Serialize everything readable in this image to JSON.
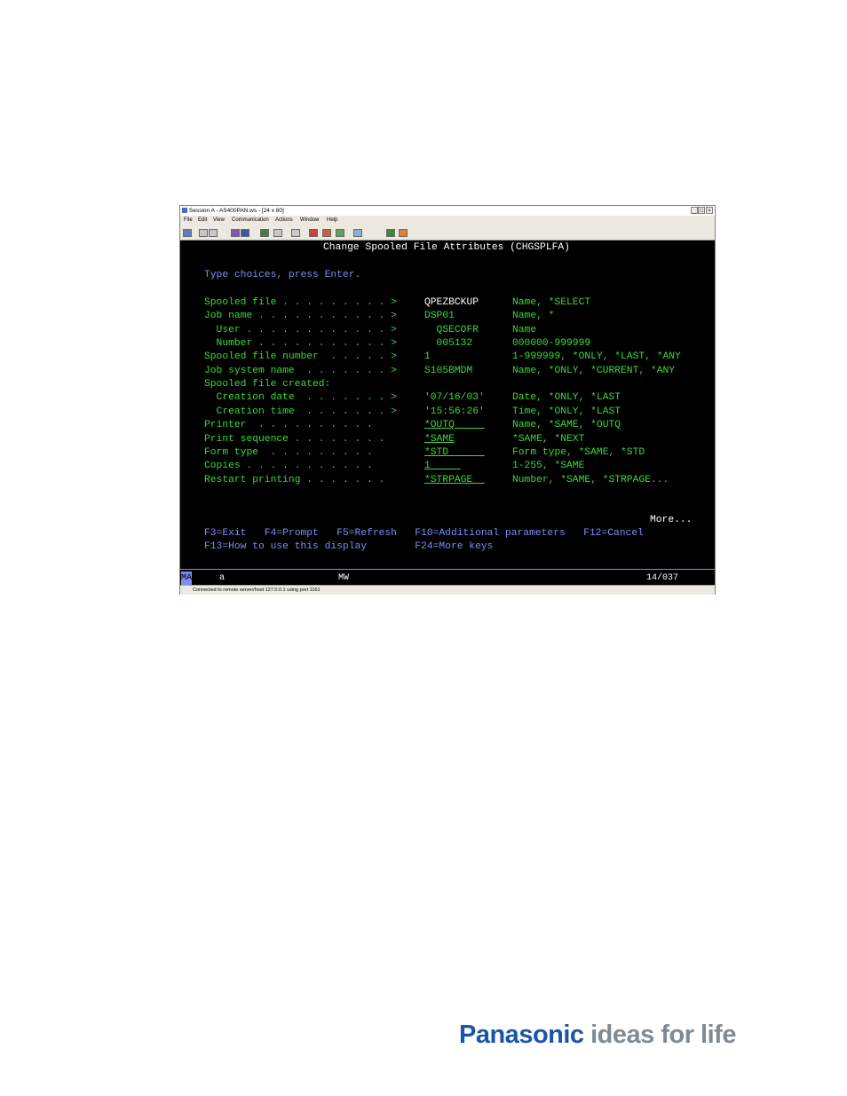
{
  "window": {
    "title": "Session A - AS400PAN.ws - [24 x 80]",
    "controls": [
      "_",
      "□",
      "×"
    ],
    "menu": [
      "File",
      "Edit",
      "View",
      "Communication",
      "Actions",
      "Window",
      "Help"
    ],
    "toolbar_icons": [
      "print-screen-icon",
      "copy-icon",
      "paste-icon",
      "send-icon",
      "receive-icon",
      "display-icon",
      "settings-icon",
      "macro-icon",
      "stop-icon",
      "record-icon",
      "play-icon",
      "keypad-icon",
      "color-icon",
      "help-icon"
    ]
  },
  "screen": {
    "title": "Change Spooled File Attributes (CHGSPLFA)",
    "instruction": "Type choices, press Enter.",
    "fields": [
      {
        "label": "Spooled file . . . . . . . . . >",
        "value": "QPEZBCKUP",
        "hint": "Name, *SELECT",
        "input": false,
        "value_color": "white"
      },
      {
        "label": "Job name . . . . . . . . . . . >",
        "value": "DSP01",
        "hint": "Name, *",
        "input": false,
        "value_color": "green"
      },
      {
        "label": "  User . . . . . . . . . . . . >",
        "value": "  QSECOFR",
        "hint": "Name",
        "input": false,
        "value_color": "green"
      },
      {
        "label": "  Number . . . . . . . . . . . >",
        "value": "  005132",
        "hint": "000000-999999",
        "input": false,
        "value_color": "green"
      },
      {
        "label": "Spooled file number  . . . . . >",
        "value": "1",
        "hint": "1-999999, *ONLY, *LAST, *ANY",
        "input": false,
        "value_color": "green"
      },
      {
        "label": "Job system name  . . . . . . . >",
        "value": "S105BMDM",
        "hint": "Name, *ONLY, *CURRENT, *ANY",
        "input": false,
        "value_color": "green"
      },
      {
        "label": "Spooled file created:",
        "value": "",
        "hint": "",
        "input": false,
        "value_color": "green"
      },
      {
        "label": "  Creation date  . . . . . . . >",
        "value": "'07/16/03'",
        "hint": "Date, *ONLY, *LAST",
        "input": false,
        "value_color": "green"
      },
      {
        "label": "  Creation time  . . . . . . . >",
        "value": "'15:56:26'",
        "hint": "Time, *ONLY, *LAST",
        "input": false,
        "value_color": "green"
      },
      {
        "label": "Printer  . . . . . . . . . .",
        "value": "*OUTQ     ",
        "hint": "Name, *SAME, *OUTQ",
        "input": true,
        "value_color": "green"
      },
      {
        "label": "Print sequence . . . . . . . .",
        "value": "*SAME",
        "hint": "*SAME, *NEXT",
        "input": true,
        "value_color": "green"
      },
      {
        "label": "Form type  . . . . . . . . .",
        "value": "*STD      ",
        "hint": "Form type, *SAME, *STD",
        "input": true,
        "value_color": "green"
      },
      {
        "label": "Copies . . . . . . . . . . .",
        "value": "1     ",
        "hint": "1-255, *SAME",
        "input": true,
        "value_color": "green"
      },
      {
        "label": "Restart printing . . . . . . .",
        "value": "*STRPAGE  ",
        "hint": "Number, *SAME, *STRPAGE...",
        "input": true,
        "value_color": "green"
      }
    ],
    "more": "More...",
    "fkeys_line1": "F3=Exit   F4=Prompt   F5=Refresh   F10=Additional parameters   F12=Cancel",
    "fkeys_line2": "F13=How to use this display        F24=More keys"
  },
  "oia": {
    "indicator": "MA",
    "session": "a",
    "mode": "MW",
    "cursor": "14/037"
  },
  "status": "Connected to remote server/host 127.0.0.1 using port 1161",
  "brand": {
    "name": "Panasonic",
    "tagline": "ideas for life"
  }
}
